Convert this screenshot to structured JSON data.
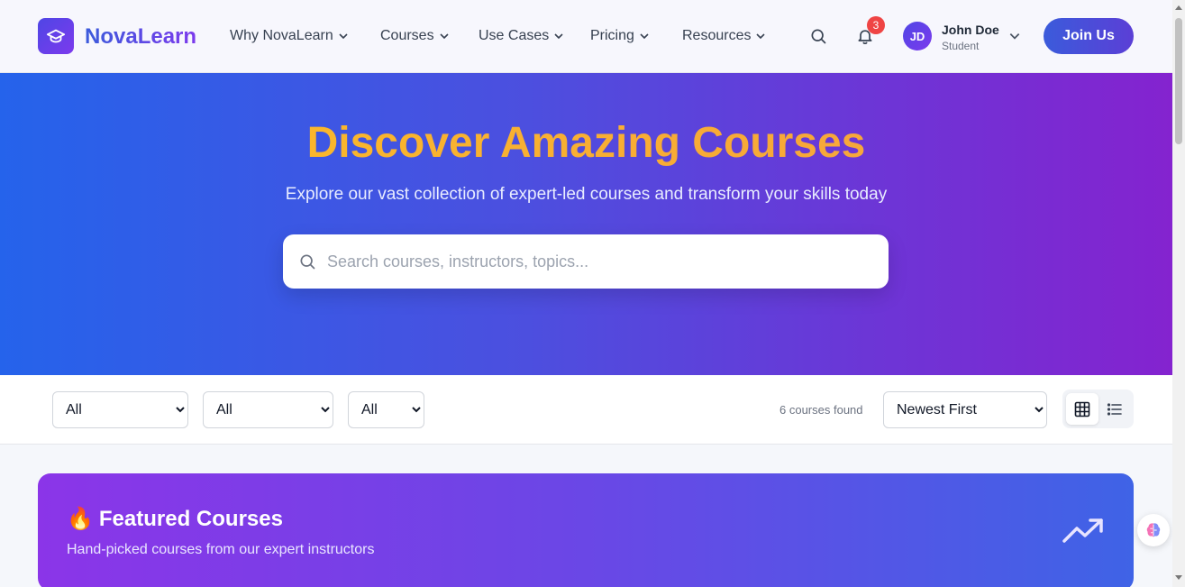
{
  "brand": {
    "name": "NovaLearn"
  },
  "nav": [
    {
      "label": "Why NovaLearn"
    },
    {
      "label": "Courses"
    },
    {
      "label": "Use Cases"
    },
    {
      "label": "Pricing"
    },
    {
      "label": "Resources"
    }
  ],
  "notifications": {
    "count": "3"
  },
  "user": {
    "initials": "JD",
    "name": "John Doe",
    "role": "Student"
  },
  "join_label": "Join Us",
  "hero": {
    "title": "Discover Amazing Courses",
    "subtitle": "Explore our vast collection of expert-led courses and transform your skills today",
    "search_placeholder": "Search courses, instructors, topics..."
  },
  "filters": {
    "filter1": "All",
    "filter2": "All",
    "filter3": "All",
    "count_text": "6 courses found",
    "sort": "Newest First"
  },
  "featured": {
    "emoji": "🔥",
    "title": "Featured Courses",
    "subtitle": "Hand-picked courses from our expert instructors"
  },
  "colors": {
    "brand_primary": "#4f46e5",
    "hero_start": "#2563eb",
    "hero_end": "#8423cf",
    "hero_title": "#fbbf24",
    "badge": "#ef4444"
  }
}
